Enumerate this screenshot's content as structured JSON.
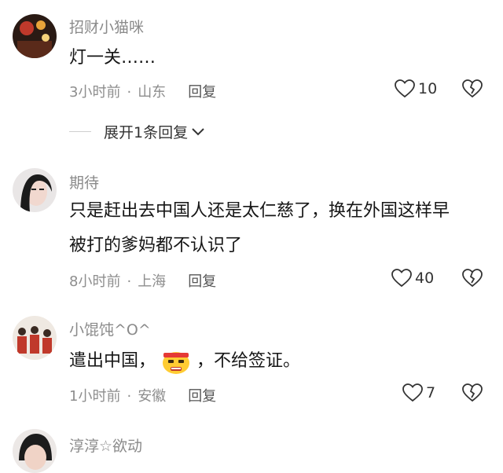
{
  "comments": [
    {
      "username": "招财小猫咪",
      "text": "灯一关……",
      "time": "3小时前",
      "location": "山东",
      "reply_label": "回复",
      "likes": "10",
      "expand_label": "展开1条回复"
    },
    {
      "username": "期待",
      "text_line1": "只是赶出去中国人还是太仁慈了，换在外国这样早",
      "text_line2": "被打的爹妈都不认识了",
      "time": "8小时前",
      "location": "上海",
      "reply_label": "回复",
      "likes": "40"
    },
    {
      "username": "小馄饨^O^",
      "text_before": "遣出中国，",
      "text_after": "，不给签证。",
      "emoji": "angry-emoji",
      "time": "1小时前",
      "location": "安徽",
      "reply_label": "回复",
      "likes": "7"
    },
    {
      "username": "淳淳☆欲动"
    }
  ],
  "separator": "·",
  "colors": {
    "meta": "#8e8e8e",
    "text": "#161616",
    "accent": "#ffcc33"
  }
}
